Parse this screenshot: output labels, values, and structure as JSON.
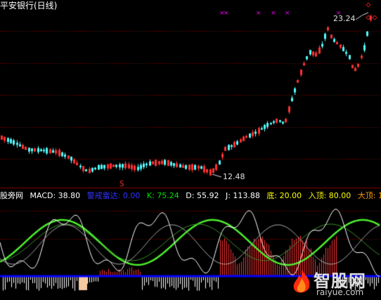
{
  "title": "平安银行(日线)",
  "price_panel": {
    "high_label": "23.24",
    "low_label": "12.48"
  },
  "indicator_legend": {
    "name": "股旁网",
    "macd": "MACD: 38.80",
    "alert": "警戒雷达: 0.00",
    "k": "K: 75.24",
    "d": "D: 55.92",
    "j": "J: 113.88",
    "bottom": "底: 20.00",
    "entry": "入顶: 80.00",
    "top": "大顶: 1"
  },
  "watermark": {
    "text": "智股网",
    "url": "raiyue.com"
  },
  "colors": {
    "background": "#000000",
    "up_candle": "#ff3232",
    "down_candle": "#54fcfc",
    "grid": "#8b0000",
    "white_line": "#ffffff",
    "green_line": "#4cf02c",
    "blue_line": "#0000ff",
    "magenta_marker": "#ff00ff",
    "legend_white": "#ffffff",
    "legend_blue": "#3232ff",
    "legend_green": "#00e000",
    "legend_yellow": "#ffff00",
    "legend_orange": "#ff9a00"
  }
}
